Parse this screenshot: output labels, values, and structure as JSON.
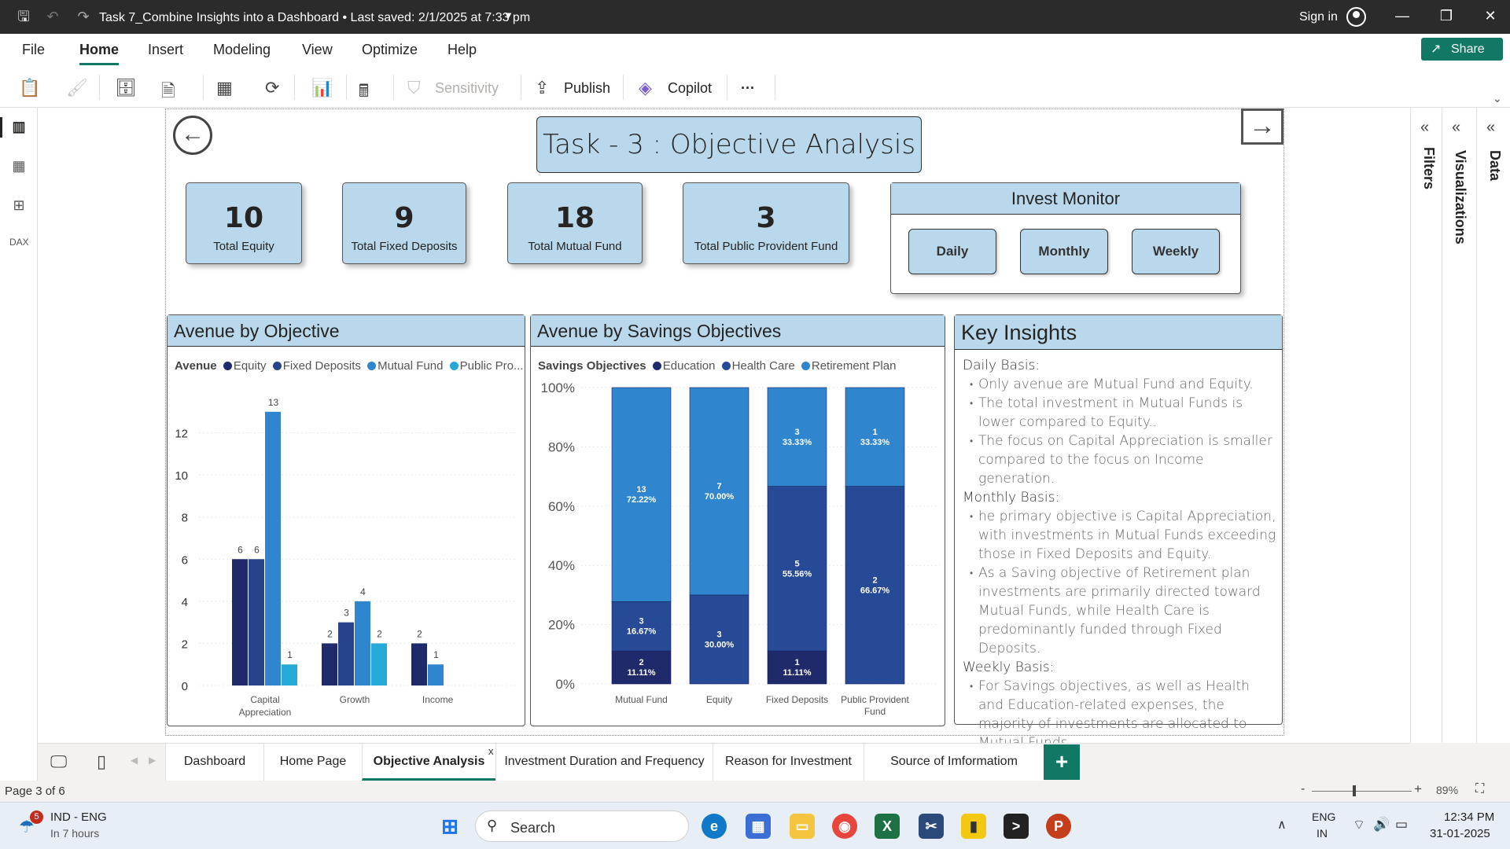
{
  "app": {
    "title": "Task 7_Combine Insights into a Dashboard • Last saved: 2/1/2025 at 7:33 pm",
    "sign_in": "Sign in"
  },
  "ribbon": {
    "tabs": [
      "File",
      "Home",
      "Insert",
      "Modeling",
      "View",
      "Optimize",
      "Help"
    ],
    "share": "Share",
    "sensitivity": "Sensitivity",
    "publish": "Publish",
    "copilot": "Copilot",
    "more": "···"
  },
  "panes": {
    "filters": "Filters",
    "visualizations": "Visualizations",
    "data": "Data"
  },
  "report": {
    "title": "Task - 3 : Objective Analysis",
    "cards": [
      {
        "value": "10",
        "label": "Total Equity"
      },
      {
        "value": "9",
        "label": "Total Fixed Deposits"
      },
      {
        "value": "18",
        "label": "Total Mutual Fund"
      },
      {
        "value": "3",
        "label": "Total Public Provident Fund"
      }
    ],
    "monitor": {
      "title": "Invest Monitor",
      "buttons": [
        "Daily",
        "Monthly",
        "Weekly"
      ]
    }
  },
  "chart_data": [
    {
      "type": "bar",
      "title": "Avenue by Objective",
      "legend_title": "Avenue",
      "categories": [
        "Capital Appreciation",
        "Growth",
        "Income"
      ],
      "series": [
        {
          "name": "Equity",
          "color": "#1f2a6b",
          "values": [
            6,
            2,
            2
          ]
        },
        {
          "name": "Fixed Deposits",
          "color": "#27438a",
          "values": [
            6,
            3,
            null
          ]
        },
        {
          "name": "Mutual Fund",
          "color": "#2f86cf",
          "values": [
            13,
            4,
            1
          ]
        },
        {
          "name": "Public Pro...",
          "color": "#25a9d6",
          "values": [
            1,
            2,
            null
          ]
        }
      ],
      "ylim": [
        0,
        13
      ],
      "yticks": [
        "0",
        "2",
        "4",
        "6",
        "8",
        "10",
        "12"
      ],
      "grid": true,
      "legend_position": "top-left"
    },
    {
      "type": "bar",
      "stacked": "100%",
      "title": "Avenue by Savings Objectives",
      "legend_title": "Savings Objectives",
      "categories": [
        "Mutual Fund",
        "Equity",
        "Fixed Deposits",
        "Public Provident Fund"
      ],
      "series": [
        {
          "name": "Education",
          "color": "#1f2a6b",
          "values": [
            2,
            null,
            1,
            null
          ],
          "pct_labels": [
            "11.11%",
            null,
            "11.11%",
            null
          ]
        },
        {
          "name": "Health Care",
          "color": "#274a97",
          "values": [
            3,
            3,
            5,
            2
          ],
          "pct_labels": [
            "16.67%",
            "30.00%",
            "55.56%",
            "66.67%"
          ]
        },
        {
          "name": "Retirement Plan",
          "color": "#2f86cf",
          "values": [
            13,
            7,
            3,
            1
          ],
          "pct_labels": [
            "72.22%",
            "70.00%",
            "33.33%",
            "33.33%"
          ]
        }
      ],
      "yticks": [
        "0%",
        "20%",
        "40%",
        "60%",
        "80%",
        "100%"
      ],
      "grid": true,
      "legend_position": "top-left"
    }
  ],
  "insights": {
    "title": "Key Insights",
    "sections": [
      {
        "heading": "Daily Basis:",
        "items": [
          "Only avenue are Mutual Fund and Equity.",
          "The total investment in Mutual Funds is lower compared to Equity..",
          "The focus on Capital Appreciation is smaller compared to the focus on Income generation."
        ]
      },
      {
        "heading": "Monthly Basis:",
        "items": [
          "he primary objective is Capital Appreciation, with investments in Mutual Funds exceeding those in Fixed Deposits and Equity.",
          "As a Saving objective of Retirement plan investments are primarily directed toward Mutual Funds, while Health Care is predominantly funded through Fixed Deposits."
        ]
      },
      {
        "heading": "Weekly Basis:",
        "items": [
          "For Savings objectives, as well as Health and Education-related expenses, the majority of investments are allocated to Mutual Funds."
        ]
      }
    ]
  },
  "pages": {
    "tabs": [
      "Dashboard",
      "Home Page",
      "Objective Analysis",
      "Investment Duration and Frequency",
      "Reason for Investment",
      "Source of Imformatiom"
    ],
    "active": "Objective Analysis",
    "close": "x",
    "add": "+"
  },
  "status": {
    "page": "Page 3 of 6",
    "zoom": "89%",
    "zoom_level": 0.4
  },
  "taskbar": {
    "weather_badge": "5",
    "weather_line1": "IND - ENG",
    "weather_line2": "In 7 hours",
    "search": "Search",
    "lang_line1": "ENG",
    "lang_line2": "IN",
    "time": "12:34 PM",
    "date": "31-01-2025"
  }
}
